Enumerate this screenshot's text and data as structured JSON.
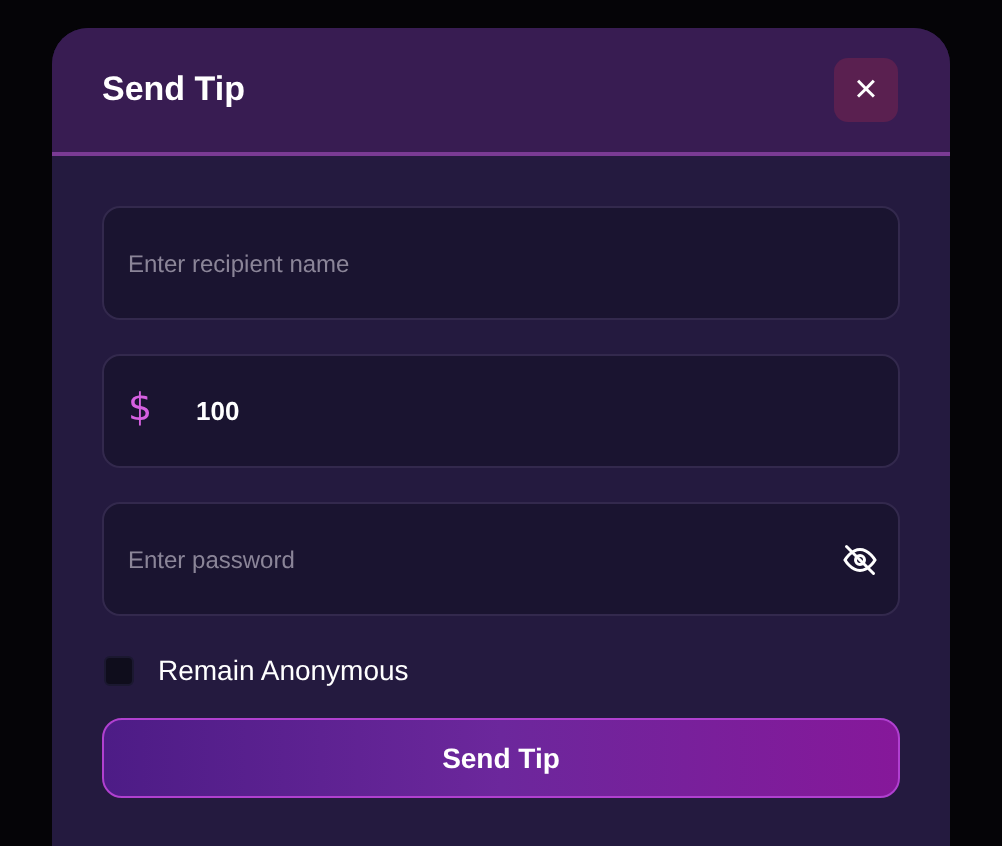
{
  "dialog": {
    "title": "Send Tip",
    "close_label": "×"
  },
  "recipient": {
    "placeholder": "Enter recipient name"
  },
  "amount": {
    "currency_symbol": "$",
    "value": "100"
  },
  "password": {
    "placeholder": "Enter password",
    "visible": false
  },
  "anonymous": {
    "label": "Remain Anonymous",
    "checked": false
  },
  "submit": {
    "label": "Send Tip"
  }
}
